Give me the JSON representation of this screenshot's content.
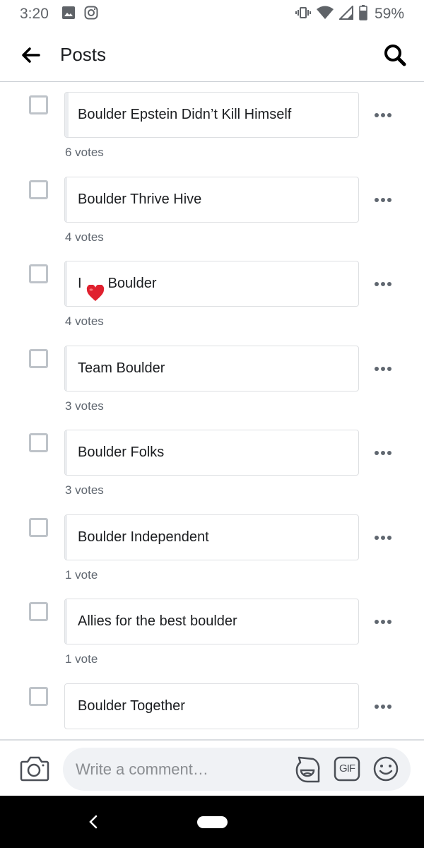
{
  "status_bar": {
    "time": "3:20",
    "left_icons": [
      "image-icon",
      "instagram-icon"
    ],
    "right_icons": [
      "vibrate-icon",
      "wifi-icon",
      "signal-icon",
      "battery-icon"
    ],
    "battery_text": "59%"
  },
  "header": {
    "back_icon": "arrow-left-icon",
    "title": "Posts",
    "search_icon": "search-icon"
  },
  "poll": {
    "options": [
      {
        "label": "Boulder Epstein Didn’t Kill Himself",
        "votes": 6,
        "votes_text": "6 votes",
        "fill_fraction": 0.012,
        "has_heart": false
      },
      {
        "label": "Boulder Thrive Hive",
        "votes": 4,
        "votes_text": "4 votes",
        "fill_fraction": 0.008,
        "has_heart": false
      },
      {
        "label_before": "I",
        "label_after": "Boulder",
        "label": "I ❤️ Boulder",
        "votes": 4,
        "votes_text": "4 votes",
        "fill_fraction": 0.008,
        "has_heart": true
      },
      {
        "label": "Team Boulder",
        "votes": 3,
        "votes_text": "3 votes",
        "fill_fraction": 0.006,
        "has_heart": false
      },
      {
        "label": "Boulder Folks",
        "votes": 3,
        "votes_text": "3 votes",
        "fill_fraction": 0.006,
        "has_heart": false
      },
      {
        "label": "Boulder Independent",
        "votes": 1,
        "votes_text": "1 vote",
        "fill_fraction": 0.002,
        "has_heart": false
      },
      {
        "label": "Allies for the best boulder",
        "votes": 1,
        "votes_text": "1 vote",
        "fill_fraction": 0.002,
        "has_heart": false
      },
      {
        "label": "Boulder Together",
        "votes": null,
        "votes_text": "",
        "fill_fraction": 0,
        "has_heart": false
      }
    ],
    "more_icon": "more-horizontal-icon"
  },
  "comment_bar": {
    "camera_icon": "camera-icon",
    "placeholder": "Write a comment…",
    "value": "",
    "sticker_icon": "sticker-icon",
    "gif_label": "GIF",
    "emoji_icon": "emoji-icon"
  },
  "nav_bar": {
    "back_icon": "nav-back-icon",
    "home_icon": "home-pill-icon"
  },
  "colors": {
    "text_primary": "#1c1e21",
    "text_secondary": "#606770",
    "border": "#dddfe2",
    "checkbox_border": "#bec3c9",
    "fill": "#ebedf0",
    "input_bg": "#f0f2f5"
  }
}
